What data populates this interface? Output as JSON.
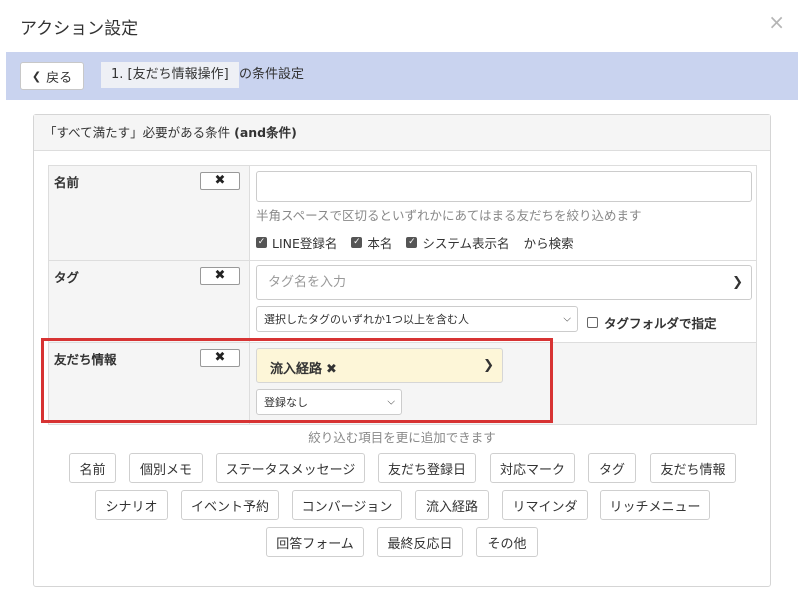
{
  "modal": {
    "title": "アクション設定",
    "close_glyph": "×"
  },
  "nav": {
    "back_label": "戻る",
    "crumb": "1. [友だち情報操作]",
    "crumb_suffix": "の条件設定"
  },
  "panel": {
    "header_prefix": "「すべて満たす」必要がある条件 ",
    "header_bold": "(and条件)"
  },
  "conditions": {
    "name": {
      "label": "名前",
      "remove_glyph": "✖",
      "input_value": "",
      "help": "半角スペースで区切るといずれかにあてはまる友だちを絞り込めます",
      "checks": [
        "LINE登録名",
        "本名",
        "システム表示名"
      ],
      "check_suffix": "から検索"
    },
    "tag": {
      "label": "タグ",
      "remove_glyph": "✖",
      "placeholder": "タグ名を入力",
      "match_mode": "選択したタグのいずれか1つ以上を含む人",
      "folder_label": "タグフォルダで指定"
    },
    "friend_info": {
      "label": "友だち情報",
      "remove_glyph": "✖",
      "chip": "流入経路",
      "chip_remove_glyph": "✖",
      "value_select": "登録なし"
    }
  },
  "add_hint": "絞り込む項目を更に追加できます",
  "add_buttons": [
    "名前",
    "個別メモ",
    "ステータスメッセージ",
    "友だち登録日",
    "対応マーク",
    "タグ",
    "友だち情報",
    "シナリオ",
    "イベント予約",
    "コンバージョン",
    "流入経路",
    "リマインダ",
    "リッチメニュー",
    "回答フォーム",
    "最終反応日",
    "その他"
  ],
  "colors": {
    "nav_bg": "#c9d3ef",
    "chip_bg": "#fdf6d8",
    "highlight": "#d73333"
  },
  "icons": {
    "back": "chevron-left-icon",
    "close": "close-icon",
    "dropdown": "chevron-down-icon",
    "remove": "remove-x-icon",
    "check": "checkbox-checked-icon"
  }
}
